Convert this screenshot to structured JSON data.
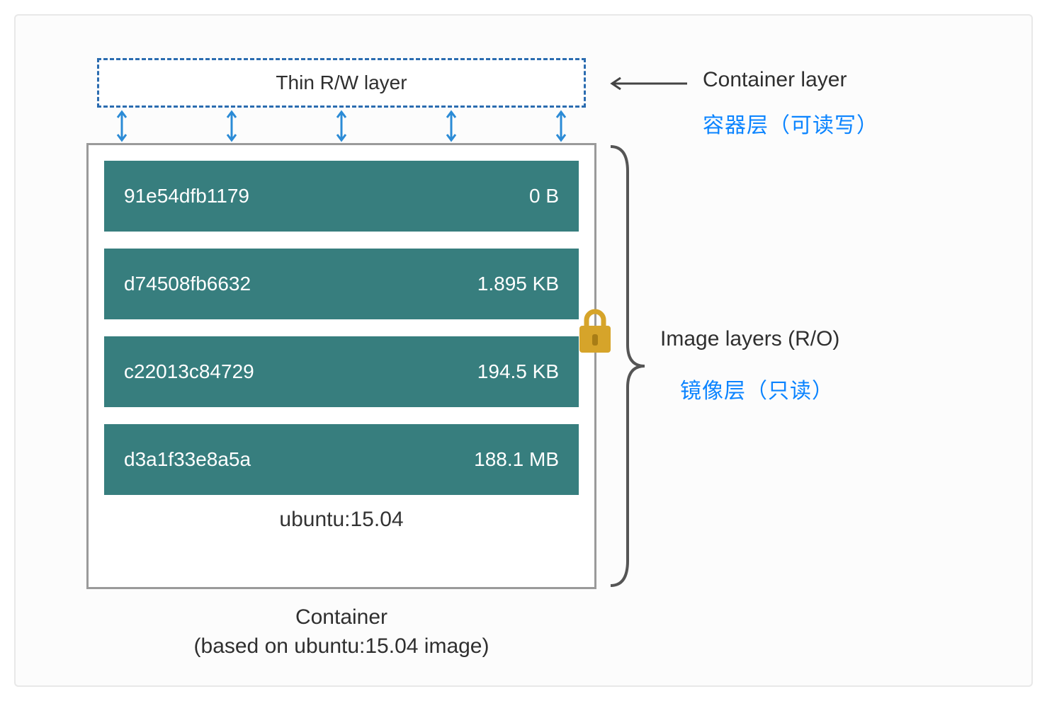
{
  "thin_layer_label": "Thin R/W layer",
  "container_layer_label": "Container layer",
  "container_layer_label_zh": "容器层（可读写）",
  "image_layers_label": "Image layers (R/O)",
  "image_layers_label_zh": "镜像层（只读）",
  "image_tag": "ubuntu:15.04",
  "caption_line1": "Container",
  "caption_line2": "(based on ubuntu:15.04 image)",
  "layers": [
    {
      "id": "91e54dfb1179",
      "size": "0 B"
    },
    {
      "id": "d74508fb6632",
      "size": "1.895 KB"
    },
    {
      "id": "c22013c84729",
      "size": "194.5 KB"
    },
    {
      "id": "d3a1f33e8a5a",
      "size": "188.1 MB"
    }
  ],
  "colors": {
    "layer_bg": "#377e7e",
    "dash_border": "#2b6cb0",
    "arrow_blue": "#2b8bd6",
    "lock_gold": "#d6a42a",
    "zh_blue": "#0b84ff"
  }
}
